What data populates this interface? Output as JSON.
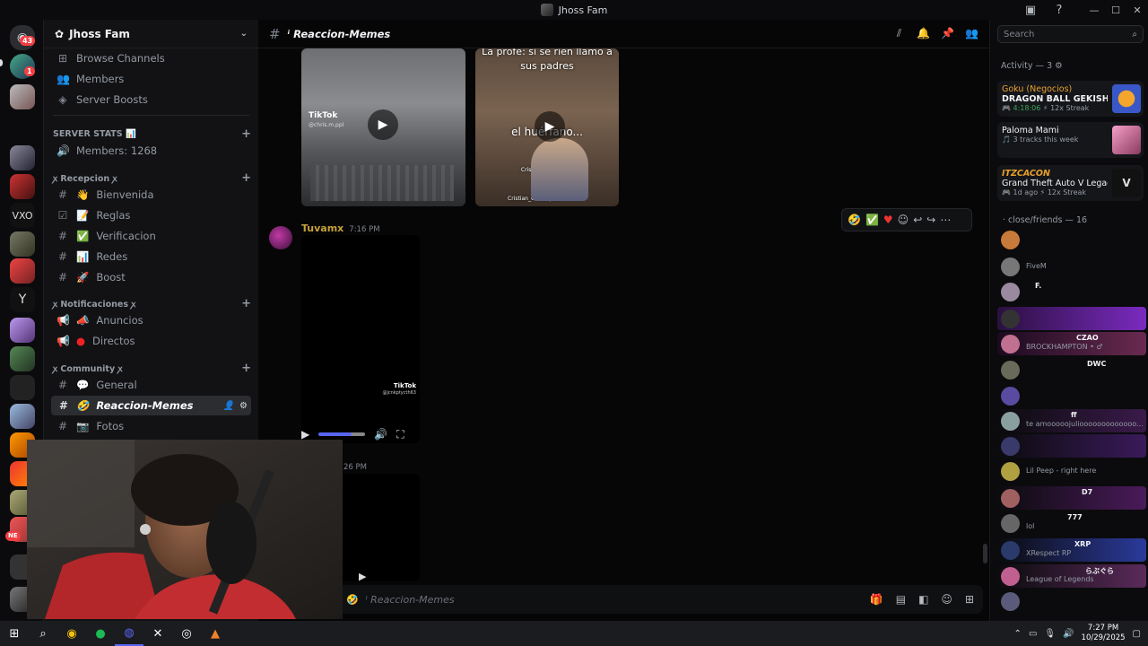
{
  "window": {
    "title": "Jhoss Fam"
  },
  "rail": {
    "mention_badge": "43",
    "badge_small": "1",
    "new_badge": "NE"
  },
  "sidebar": {
    "server_name": "Jhoss Fam",
    "top_items": [
      {
        "label": "Browse Channels",
        "icon": "grid-icon"
      },
      {
        "label": "Members",
        "icon": "members-icon"
      },
      {
        "label": "Server Boosts",
        "icon": "boost-icon"
      }
    ],
    "categories": {
      "stats": "SERVER STATS 📊",
      "recepcion": "ꭗ Recepcion ꭗ",
      "notificaciones": "ꭗ Notificaciones ꭗ",
      "community": "ꭗ Community ꭗ"
    },
    "channels": {
      "members": "Members: 1268",
      "bienvenida": "Bienvenida",
      "reglas": "Reglas",
      "verificacion": "Verificacion",
      "redes": "Redes",
      "boost": "Boost",
      "anuncios": "Anuncios",
      "directos": "Directos",
      "general": "General",
      "reaccion": "Reaccion-Memes",
      "fotos": "Fotos"
    },
    "channel_prefix": "ⁱ"
  },
  "main": {
    "channel_name": "ⁱ Reaccion-Memes",
    "video2_caption_top": "La profe: si se rien llamo a sus padres",
    "video2_caption_mid": "el huérfano...",
    "video2_credit": "Cristian_Camilopriv",
    "tiktok_label": "TikTok",
    "tiktok_handle": "@chris.m.ppl",
    "tiktok_handle2": "@jcnkptycth63",
    "message_author": "Tuvamx",
    "message_time": "7:16 PM",
    "next_time": "26 PM",
    "composer_placeholder": "ⁱ Reaccion-Memes"
  },
  "activity": {
    "search_placeholder": "Search",
    "title": "Activity — 3",
    "cards": [
      {
        "line1": "Goku (Negocios)",
        "line2": "DRAGON BALL GEKISHIN ...",
        "time": "4:18:06",
        "streak": "12x Streak"
      },
      {
        "line1": "",
        "line2": "Paloma Mami",
        "line3": "3 tracks this week"
      },
      {
        "line1": "ITZCACON",
        "line2": "Grand Theft Auto V Legacy",
        "line3": "1d ago",
        "streak": "12x Streak"
      }
    ],
    "friends_header": "· close/friends — 16",
    "friends": [
      {
        "status": "",
        "tag": ""
      },
      {
        "status": "FiveM",
        "tag": ""
      },
      {
        "status": "",
        "tag": "F."
      },
      {
        "status": "",
        "tag": ""
      },
      {
        "status": "BROCKHAMPTON • ♂",
        "tag": "CZAO"
      },
      {
        "status": "",
        "tag": "DWC"
      },
      {
        "status": "",
        "tag": ""
      },
      {
        "status": "te amooooojuliooooooooooooo...",
        "tag": "ff"
      },
      {
        "status": "",
        "tag": ""
      },
      {
        "status": "Lil Peep - right here",
        "tag": ""
      },
      {
        "status": "",
        "tag": "D7"
      },
      {
        "status": "lol",
        "tag": "777"
      },
      {
        "status": "XRespect RP",
        "tag": "XRP"
      },
      {
        "status": "League of Legends",
        "tag": "らぶぐら"
      },
      {
        "status": "",
        "tag": ""
      }
    ]
  },
  "taskbar": {
    "time": "7:27 PM",
    "date": "10/29/2025"
  },
  "colors": {
    "accent": "#5865f2",
    "author": "#c7a03c",
    "mention": "#f23f43"
  }
}
